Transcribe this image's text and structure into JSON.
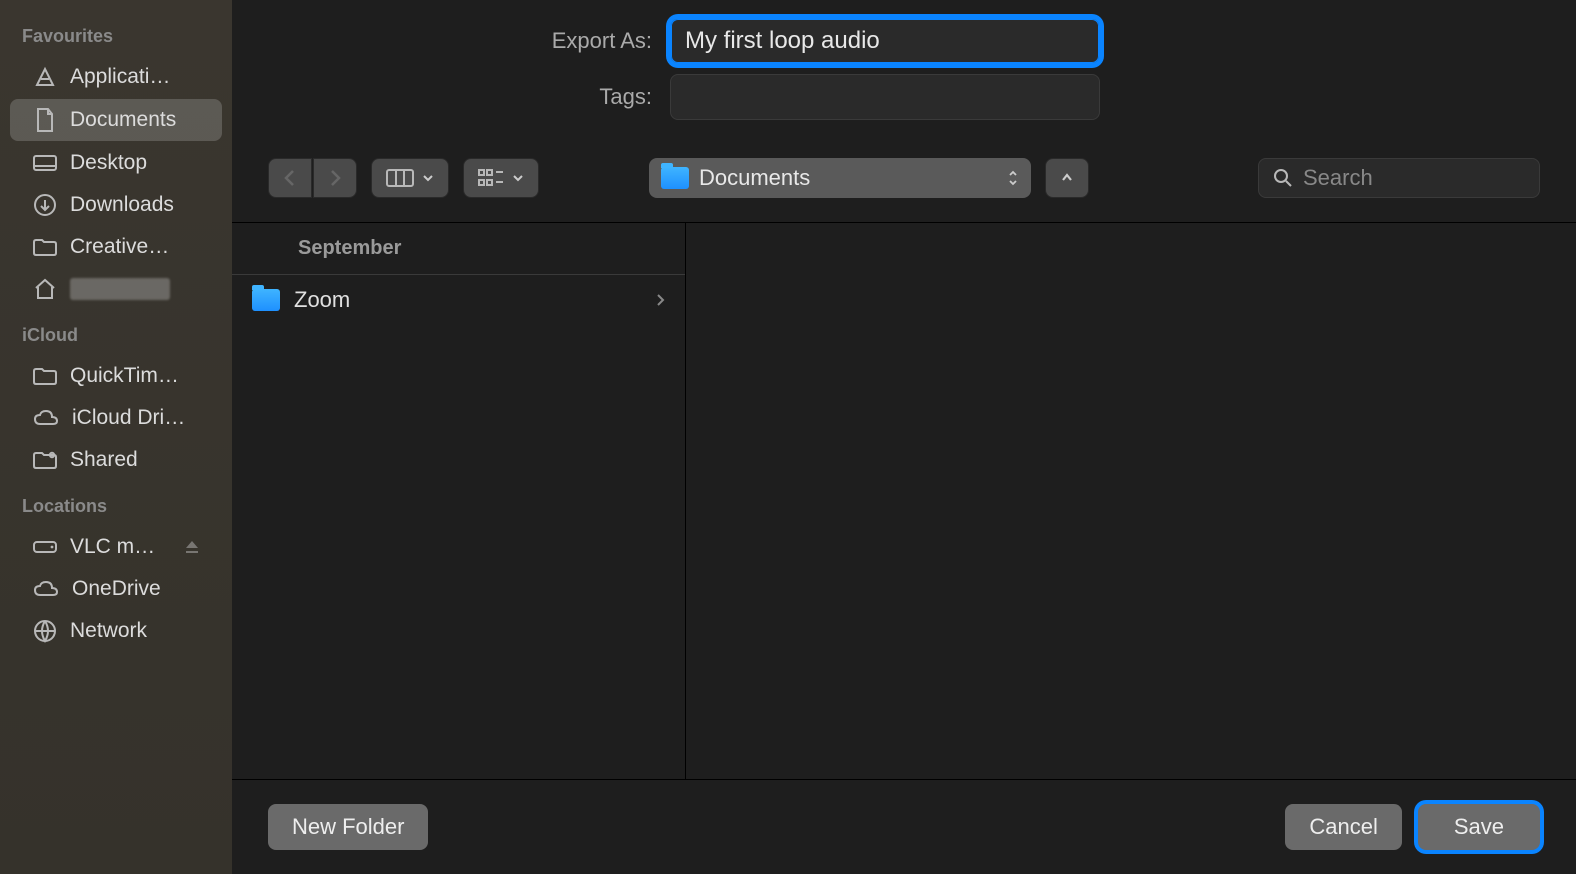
{
  "sidebar": {
    "sections": [
      {
        "title": "Favourites",
        "items": [
          {
            "label": "Applicati…",
            "icon": "apps"
          },
          {
            "label": "Documents",
            "icon": "doc",
            "selected": true
          },
          {
            "label": "Desktop",
            "icon": "desktop"
          },
          {
            "label": "Downloads",
            "icon": "download"
          },
          {
            "label": "Creative…",
            "icon": "folder"
          },
          {
            "label": "",
            "icon": "home",
            "redacted": true
          }
        ]
      },
      {
        "title": "iCloud",
        "items": [
          {
            "label": "QuickTim…",
            "icon": "folder"
          },
          {
            "label": "iCloud Dri…",
            "icon": "cloud"
          },
          {
            "label": "Shared",
            "icon": "shared"
          }
        ]
      },
      {
        "title": "Locations",
        "items": [
          {
            "label": "VLC m…",
            "icon": "disk",
            "eject": true
          },
          {
            "label": "OneDrive",
            "icon": "cloud"
          },
          {
            "label": "Network",
            "icon": "globe"
          }
        ]
      }
    ]
  },
  "form": {
    "export_label": "Export As:",
    "export_value": "My first loop audio",
    "tags_label": "Tags:",
    "tags_value": ""
  },
  "toolbar": {
    "location": "Documents",
    "search_placeholder": "Search"
  },
  "browser": {
    "group": "September",
    "items": [
      {
        "label": "Zoom",
        "kind": "folder"
      }
    ]
  },
  "footer": {
    "new_folder": "New Folder",
    "cancel": "Cancel",
    "save": "Save"
  }
}
